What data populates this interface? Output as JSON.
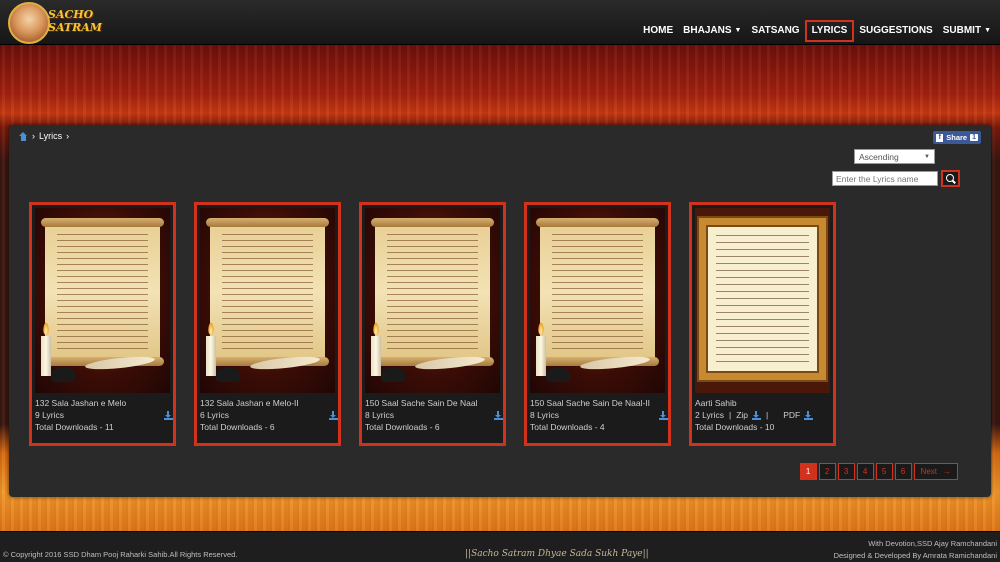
{
  "logo": {
    "line1": "SACHO",
    "line2": "SATRAM"
  },
  "nav": [
    {
      "label": "HOME",
      "dropdown": false,
      "active": false
    },
    {
      "label": "BHAJANS",
      "dropdown": true,
      "active": false
    },
    {
      "label": "SATSANG",
      "dropdown": false,
      "active": false
    },
    {
      "label": "LYRICS",
      "dropdown": false,
      "active": true
    },
    {
      "label": "SUGGESTIONS",
      "dropdown": false,
      "active": false
    },
    {
      "label": "SUBMIT",
      "dropdown": true,
      "active": false
    }
  ],
  "breadcrumb": {
    "current": "Lyrics"
  },
  "share": {
    "label": "Share",
    "count": "1"
  },
  "sort": {
    "selected": "Ascending"
  },
  "search": {
    "placeholder": "Enter the Lyrics name"
  },
  "cards": [
    {
      "title": "132 Sala Jashan e Melo",
      "lyrics": "9 Lyrics",
      "downloads": "Total Downloads - 11"
    },
    {
      "title": "132 Sala Jashan e Melo-II",
      "lyrics": "6 Lyrics",
      "downloads": "Total Downloads - 6"
    },
    {
      "title": "150 Saal Sache Sain De Naal",
      "lyrics": "8 Lyrics",
      "downloads": "Total Downloads - 6"
    },
    {
      "title": "150 Saal Sache Sain De Naal-II",
      "lyrics": "8 Lyrics",
      "downloads": "Total Downloads - 4"
    },
    {
      "title": "Aarti Sahib",
      "lyrics": "2 Lyrics",
      "zip": "Zip",
      "pdf": "PDF",
      "downloads": "Total Downloads - 10"
    }
  ],
  "pagination": {
    "pages": [
      "1",
      "2",
      "3",
      "4",
      "5",
      "6"
    ],
    "active": "1",
    "next": "Next"
  },
  "footer": {
    "copyright": "© Copyright 2016 SSD Dham Pooj Raharki Sahib.All Rights Reserved.",
    "tagline": "||Sacho Satram Dhyae Sada Sukh Paye||",
    "credit1": "With Devotion,SSD Ajay Ramchandani",
    "credit2": "Designed & Developed By Amrata Ramichandani"
  },
  "colors": {
    "accent": "#d2321c",
    "link_blue": "#4a90d9",
    "facebook": "#3b5998"
  }
}
